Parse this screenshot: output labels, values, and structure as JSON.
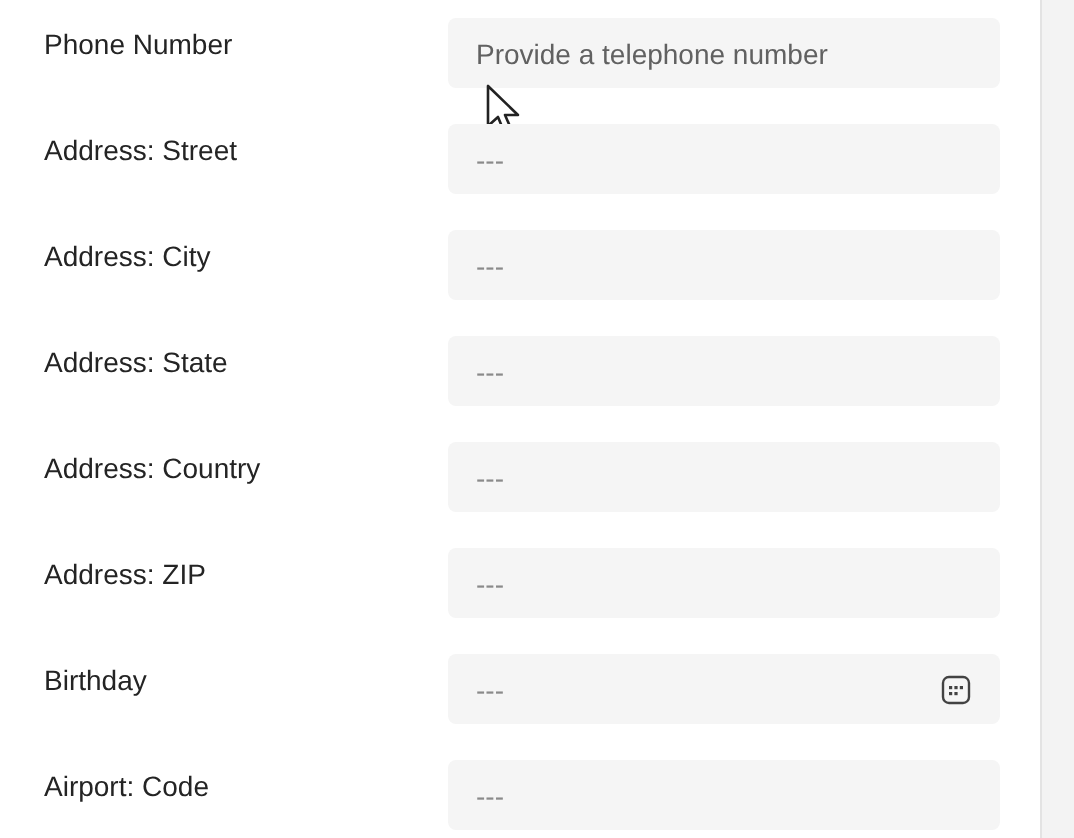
{
  "fields": [
    {
      "label": "Phone Number",
      "kind": "text",
      "placeholder": "Provide a telephone number",
      "hovered": true
    },
    {
      "label": "Address: Street",
      "kind": "text",
      "placeholder": "---",
      "hovered": false
    },
    {
      "label": "Address: City",
      "kind": "text",
      "placeholder": "---",
      "hovered": false
    },
    {
      "label": "Address: State",
      "kind": "text",
      "placeholder": "---",
      "hovered": false
    },
    {
      "label": "Address: Country",
      "kind": "text",
      "placeholder": "---",
      "hovered": false
    },
    {
      "label": "Address: ZIP",
      "kind": "text",
      "placeholder": "---",
      "hovered": false
    },
    {
      "label": "Birthday",
      "kind": "date",
      "placeholder": "---",
      "hovered": false
    },
    {
      "label": "Airport: Code",
      "kind": "text",
      "placeholder": "---",
      "hovered": false
    }
  ]
}
